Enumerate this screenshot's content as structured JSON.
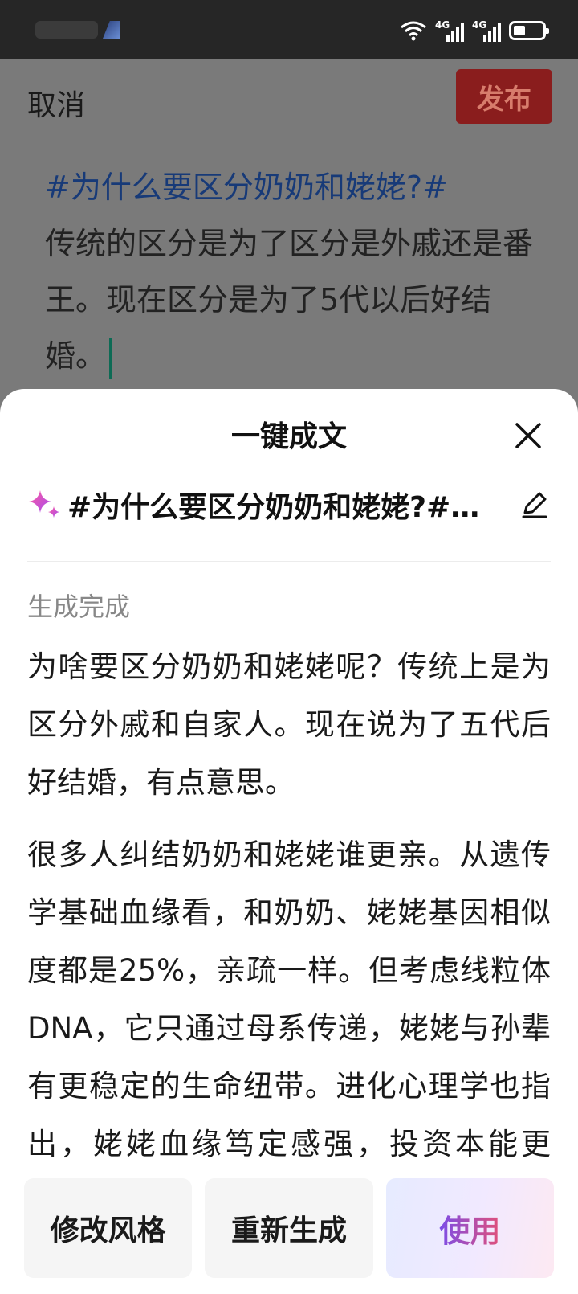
{
  "composer": {
    "cancel_label": "取消",
    "publish_label": "发布",
    "hashtag": "#为什么要区分奶奶和姥姥?#",
    "body": "传统的区分是为了区分是外戚还是番王。现在区分是为了5代以后好结婚。"
  },
  "sheet": {
    "title": "一键成文",
    "topic": "#为什么要区分奶奶和姥姥?#传统的区分是为了区分是外戚还是番王。现在区分是为了5代以后好结婚。",
    "status": "生成完成",
    "paragraphs": [
      "为啥要区分奶奶和姥姥呢？传统上是为区分外戚和自家人。现在说为了五代后好结婚，有点意思。",
      "很多人纠结奶奶和姥姥谁更亲。从遗传学基础血缘看，和奶奶、姥姥基因相似度都是25%，亲疏一样。但考虑线粒体DNA，它只通过母系传递，姥姥与孙辈有更稳定的生命纽带。进化心理学也指出，姥姥血缘笃定感强，投资本能更足，研究"
    ],
    "actions": {
      "modify_style": "修改风格",
      "regenerate": "重新生成",
      "use": "使用"
    }
  },
  "status_bar": {
    "network_1": "4G",
    "network_2": "4G"
  },
  "colors": {
    "hashtag": "#173a78",
    "publish_bg": "#8a1d1d",
    "use_gradient_start": "#7b4de8",
    "use_gradient_end": "#e0507a"
  }
}
